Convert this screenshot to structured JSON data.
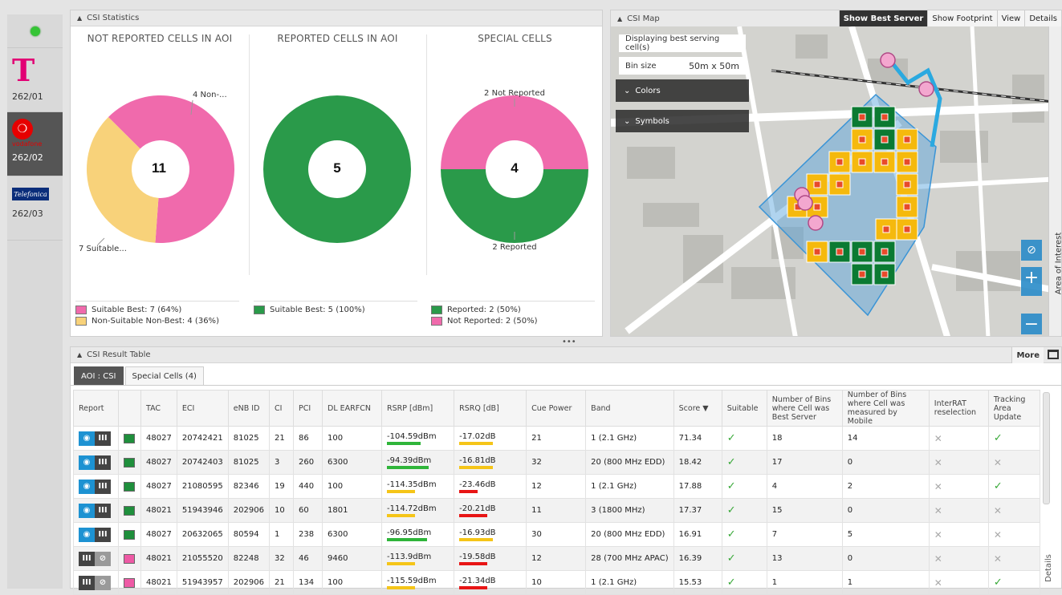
{
  "operators": [
    {
      "code": "262/01",
      "brand": "T",
      "active": false
    },
    {
      "code": "262/02",
      "brand": "vodafone",
      "active": true
    },
    {
      "code": "262/03",
      "brand": "Telefonica",
      "active": false
    }
  ],
  "stats": {
    "title": "CSI Statistics",
    "charts": [
      {
        "title": "NOT REPORTED CELLS IN AOI",
        "center": "11",
        "label_top": "4 Non-...",
        "label_bottom": "7 Suitable...",
        "legend": [
          "Suitable Best: 7 (64%)",
          "Non-Suitable Non-Best: 4 (36%)"
        ],
        "legend_colors": [
          "#f06aac",
          "#f8d27a"
        ]
      },
      {
        "title": "REPORTED CELLS IN AOI",
        "center": "5",
        "legend": [
          "Suitable Best: 5 (100%)"
        ],
        "legend_colors": [
          "#2a9a4a"
        ]
      },
      {
        "title": "SPECIAL CELLS",
        "center": "4",
        "label_top": "2 Not Reported",
        "label_bottom": "2 Reported",
        "legend": [
          "Reported: 2 (50%)",
          "Not Reported: 2 (50%)"
        ],
        "legend_colors": [
          "#2a9a4a",
          "#f06aac"
        ]
      }
    ]
  },
  "chart_data": [
    {
      "type": "pie",
      "title": "NOT REPORTED CELLS IN AOI",
      "categories": [
        "Suitable Best",
        "Non-Suitable Non-Best"
      ],
      "values": [
        7,
        4
      ],
      "colors": [
        "#f06aac",
        "#f8d27a"
      ]
    },
    {
      "type": "pie",
      "title": "REPORTED CELLS IN AOI",
      "categories": [
        "Suitable Best"
      ],
      "values": [
        5
      ],
      "colors": [
        "#2a9a4a"
      ]
    },
    {
      "type": "pie",
      "title": "SPECIAL CELLS",
      "categories": [
        "Not Reported",
        "Reported"
      ],
      "values": [
        2,
        2
      ],
      "colors": [
        "#f06aac",
        "#2a9a4a"
      ]
    }
  ],
  "map": {
    "title": "CSI Map",
    "buttons": [
      "Show Best Server",
      "Show Footprint",
      "View",
      "Details"
    ],
    "info_text": "Displaying best serving cell(s)",
    "bin_label": "Bin size",
    "bin_value": "50m x 50m",
    "colors_label": "Colors",
    "symbols_label": "Symbols",
    "side_label": "Area of Interest",
    "zoom_in": "+",
    "zoom_out": "−"
  },
  "results": {
    "title": "CSI Result Table",
    "more_label": "More",
    "details_label": "Details",
    "tabs": [
      "AOI : CSI",
      "Special Cells (4)"
    ],
    "columns": [
      "Report",
      "",
      "TAC",
      "ECI",
      "eNB ID",
      "CI",
      "PCI",
      "DL EARFCN",
      "RSRP [dBm]",
      "RSRQ [dB]",
      "Cue Power",
      "Band",
      "Score ▼",
      "Suitable",
      "Number of Bins where Cell was Best Server",
      "Number of Bins where Cell was measured by Mobile",
      "InterRAT reselection",
      "Tracking Area Update"
    ],
    "rows": [
      {
        "reported": true,
        "color": "#1f8f3c",
        "tac": "48027",
        "eci": "20742421",
        "enb": "81025",
        "ci": "21",
        "pci": "86",
        "earfcn": "100",
        "rsrp": "-104.59dBm",
        "rsrp_level": 0.55,
        "rsrp_color": "#2fb53a",
        "rsrq": "-17.02dB",
        "rsrq_level": 0.55,
        "rsrq_color": "#f5c518",
        "cue": "21",
        "band": "1 (2.1 GHz)",
        "score": "71.34",
        "suitable": true,
        "bins_best": "18",
        "bins_measured": "14",
        "interrat": false,
        "tau": true
      },
      {
        "reported": true,
        "color": "#1f8f3c",
        "tac": "48027",
        "eci": "20742403",
        "enb": "81025",
        "ci": "3",
        "pci": "260",
        "earfcn": "6300",
        "rsrp": "-94.39dBm",
        "rsrp_level": 0.68,
        "rsrp_color": "#2fb53a",
        "rsrq": "-16.81dB",
        "rsrq_level": 0.55,
        "rsrq_color": "#f5c518",
        "cue": "32",
        "band": "20 (800 MHz EDD)",
        "score": "18.42",
        "suitable": true,
        "bins_best": "17",
        "bins_measured": "0",
        "interrat": false,
        "tau": false
      },
      {
        "reported": true,
        "color": "#1f8f3c",
        "tac": "48027",
        "eci": "21080595",
        "enb": "82346",
        "ci": "19",
        "pci": "440",
        "earfcn": "100",
        "rsrp": "-114.35dBm",
        "rsrp_level": 0.45,
        "rsrp_color": "#f5c518",
        "rsrq": "-23.46dB",
        "rsrq_level": 0.3,
        "rsrq_color": "#e81515",
        "cue": "12",
        "band": "1 (2.1 GHz)",
        "score": "17.88",
        "suitable": true,
        "bins_best": "4",
        "bins_measured": "2",
        "interrat": false,
        "tau": true
      },
      {
        "reported": true,
        "color": "#1f8f3c",
        "tac": "48021",
        "eci": "51943946",
        "enb": "202906",
        "ci": "10",
        "pci": "60",
        "earfcn": "1801",
        "rsrp": "-114.72dBm",
        "rsrp_level": 0.45,
        "rsrp_color": "#f5c518",
        "rsrq": "-20.21dB",
        "rsrq_level": 0.45,
        "rsrq_color": "#e81515",
        "cue": "11",
        "band": "3 (1800 MHz)",
        "score": "17.37",
        "suitable": true,
        "bins_best": "15",
        "bins_measured": "0",
        "interrat": false,
        "tau": false
      },
      {
        "reported": true,
        "color": "#1f8f3c",
        "tac": "48027",
        "eci": "20632065",
        "enb": "80594",
        "ci": "1",
        "pci": "238",
        "earfcn": "6300",
        "rsrp": "-96.95dBm",
        "rsrp_level": 0.65,
        "rsrp_color": "#2fb53a",
        "rsrq": "-16.93dB",
        "rsrq_level": 0.55,
        "rsrq_color": "#f5c518",
        "cue": "30",
        "band": "20 (800 MHz EDD)",
        "score": "16.91",
        "suitable": true,
        "bins_best": "7",
        "bins_measured": "5",
        "interrat": false,
        "tau": false
      },
      {
        "reported": false,
        "color": "#ee5aa5",
        "tac": "48021",
        "eci": "21055520",
        "enb": "82248",
        "ci": "32",
        "pci": "46",
        "earfcn": "9460",
        "rsrp": "-113.9dBm",
        "rsrp_level": 0.45,
        "rsrp_color": "#f5c518",
        "rsrq": "-19.58dB",
        "rsrq_level": 0.45,
        "rsrq_color": "#e81515",
        "cue": "12",
        "band": "28 (700 MHz APAC)",
        "score": "16.39",
        "suitable": true,
        "bins_best": "13",
        "bins_measured": "0",
        "interrat": false,
        "tau": false
      },
      {
        "reported": false,
        "color": "#ee5aa5",
        "tac": "48021",
        "eci": "51943957",
        "enb": "202906",
        "ci": "21",
        "pci": "134",
        "earfcn": "100",
        "rsrp": "-115.59dBm",
        "rsrp_level": 0.45,
        "rsrp_color": "#f5c518",
        "rsrq": "-21.34dB",
        "rsrq_level": 0.45,
        "rsrq_color": "#e81515",
        "cue": "10",
        "band": "1 (2.1 GHz)",
        "score": "15.53",
        "suitable": true,
        "bins_best": "1",
        "bins_measured": "1",
        "interrat": false,
        "tau": true
      }
    ]
  }
}
